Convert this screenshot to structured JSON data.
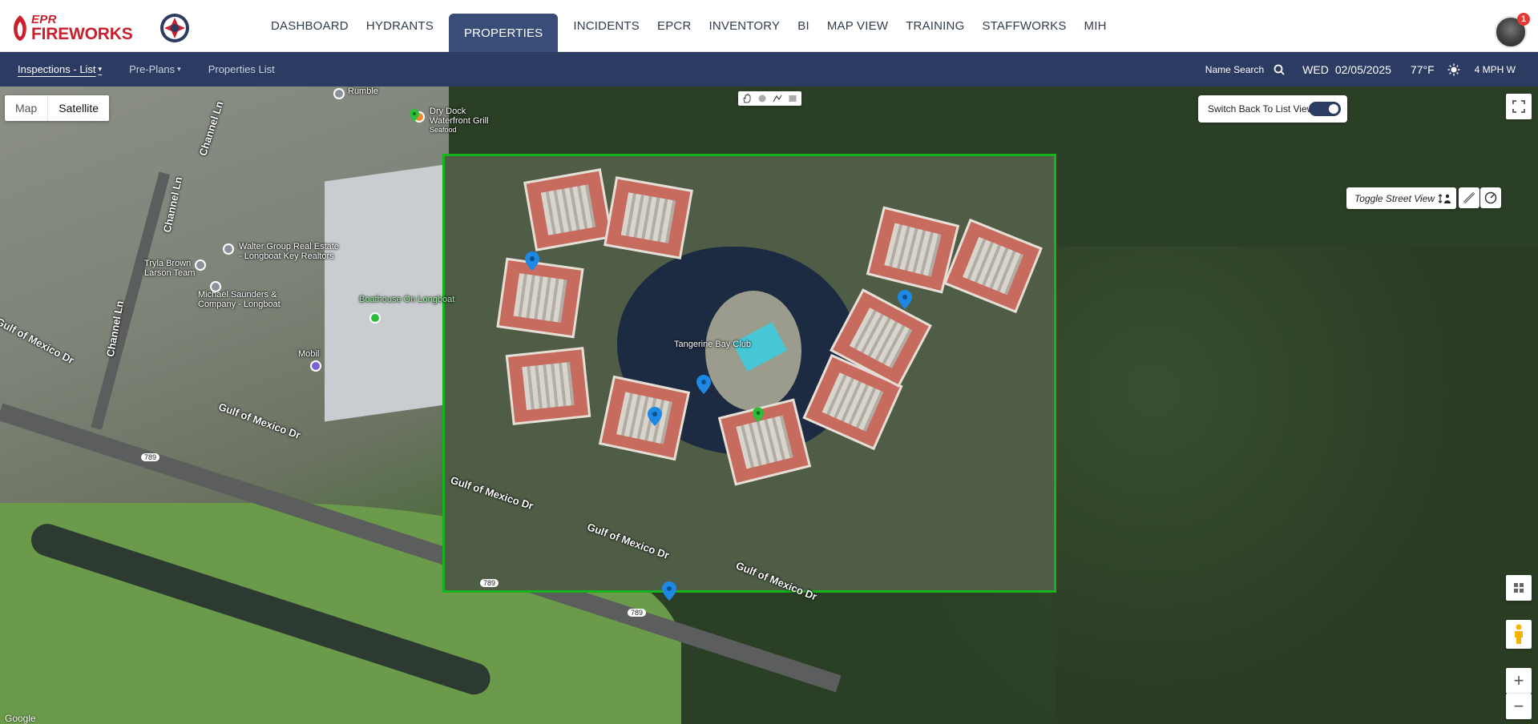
{
  "brand": {
    "line1": "EPR",
    "line2": "FIREWORKS"
  },
  "nav": [
    {
      "label": "DASHBOARD"
    },
    {
      "label": "HYDRANTS"
    },
    {
      "label": "PROPERTIES"
    },
    {
      "label": "INCIDENTS"
    },
    {
      "label": "EPCR"
    },
    {
      "label": "INVENTORY"
    },
    {
      "label": "BI"
    },
    {
      "label": "MAP VIEW"
    },
    {
      "label": "TRAINING"
    },
    {
      "label": "STAFFWORKS"
    },
    {
      "label": "MIH"
    }
  ],
  "nav_active": "PROPERTIES",
  "user": {
    "notifications": "1"
  },
  "subnav": {
    "items": [
      {
        "label": "Inspections - List",
        "has_caret": true
      },
      {
        "label": "Pre-Plans",
        "has_caret": true
      },
      {
        "label": "Properties List",
        "has_caret": false
      }
    ],
    "name_search": "Name Search",
    "day": "WED",
    "date": "02/05/2025",
    "temp": "77°F",
    "wind": "4 MPH W"
  },
  "map": {
    "map_type": {
      "map": "Map",
      "satellite": "Satellite",
      "selected": "Satellite"
    },
    "switch_label": "Switch Back To List View",
    "switch_on": true,
    "street_view_label": "Toggle Street View",
    "labels": {
      "rumble": "Rumble",
      "dry_dock": "Dry Dock\nWaterfront Grill",
      "seafood": "Seafood",
      "walter_group": "Walter Group Real Estate\n- Longboat Key Realtors",
      "tryla": "Tryla Brown\nLarson Team",
      "michael": "Michael Saunders &\nCompany - Longboat",
      "boathouse": "Boathouse On Longboat",
      "mobil": "Mobil",
      "tangerine": "Tangerine Bay Club",
      "channel_ln_1": "Channel Ln",
      "channel_ln_2": "Channel Ln",
      "channel_ln_3": "Channel Ln",
      "gulf_1": "Gulf of Mexico Dr",
      "gulf_2": "Gulf of Mexico Dr",
      "gulf_3": "Gulf of Mexico Dr",
      "gulf_4": "Gulf of Mexico Dr",
      "gulf_5": "Gulf of Mexico Dr",
      "route_789_a": "789",
      "route_789_b": "789",
      "route_789_c": "789",
      "google": "Google"
    },
    "colors": {
      "highlight": "#16b31e",
      "pin": "#1e88e5",
      "pin_green": "#2ebd3a"
    }
  }
}
